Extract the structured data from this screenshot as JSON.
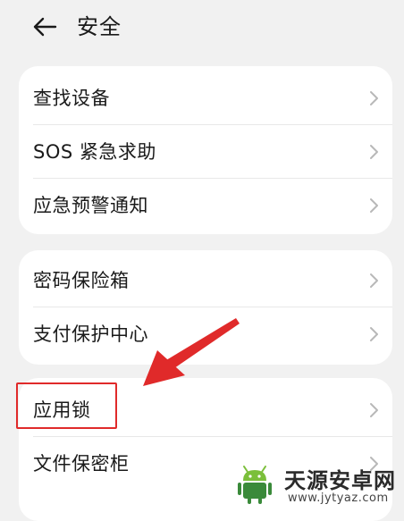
{
  "header": {
    "title": "安全",
    "back_icon": "arrow-left-icon"
  },
  "groups": [
    {
      "items": [
        {
          "label": "查找设备"
        },
        {
          "label": "SOS 紧急求助"
        },
        {
          "label": "应急预警通知"
        }
      ]
    },
    {
      "items": [
        {
          "label": "密码保险箱"
        },
        {
          "label": "支付保护中心"
        }
      ]
    },
    {
      "items": [
        {
          "label": "应用锁"
        },
        {
          "label": "文件保密柜"
        }
      ]
    }
  ],
  "annotation": {
    "color": "#e02a2a",
    "highlighted_item": "应用锁"
  },
  "watermark": {
    "name": "天源安卓网",
    "url": "www.jytyaz.com"
  },
  "colors": {
    "background": "#f1f1f1",
    "card": "#ffffff",
    "text": "#1a1a1a",
    "chevron": "#b8b8b8"
  }
}
